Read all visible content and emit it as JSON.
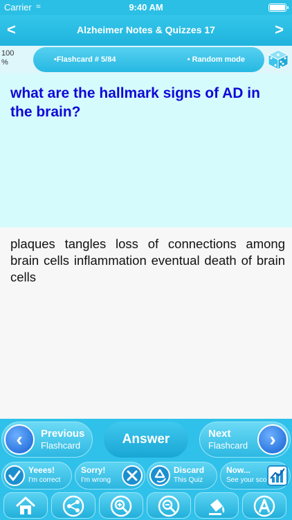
{
  "status_bar": {
    "carrier": "Carrier",
    "time": "9:40 AM"
  },
  "nav": {
    "back_glyph": "<",
    "title": "Alzheimer Notes & Quizzes 17",
    "forward_glyph": ">"
  },
  "info": {
    "progress_percent": "100 %",
    "flashcard_label": "•Flashcard #  5/84",
    "mode_label": "• Random mode"
  },
  "question": "what are the hallmark signs of AD in the brain?",
  "answer": "plaques tangles loss of connections among brain cells inflammation eventual death of brain cells",
  "controls": {
    "previous": {
      "main": "Previous",
      "sub": "Flashcard"
    },
    "answer": "Answer",
    "next": {
      "main": "Next",
      "sub": "Flashcard"
    }
  },
  "actions": [
    {
      "main": "Yeees!",
      "sub": "I'm correct",
      "icon": "check-icon"
    },
    {
      "main": "Sorry!",
      "sub": "I'm wrong",
      "icon": "x-icon"
    },
    {
      "main": "Discard",
      "sub": "This Quiz",
      "icon": "recycle-icon"
    },
    {
      "main": "Now...",
      "sub": "See your score",
      "icon": "chart-icon"
    }
  ],
  "toolbar": [
    "home-icon",
    "share-icon",
    "zoom-in-icon",
    "zoom-out-icon",
    "paint-icon",
    "font-icon"
  ],
  "colors": {
    "accent": "#2fc1ea",
    "question_text": "#0e08d6",
    "question_bg": "#d6fbfd",
    "answer_bg": "#f7f7f7"
  }
}
